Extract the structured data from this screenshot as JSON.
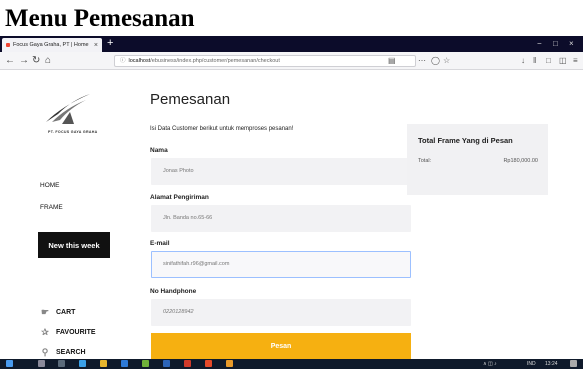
{
  "doc_title": "Menu Pemesanan",
  "browser": {
    "tab_title": "Focus Gaya Graha, PT | Home",
    "tab_close": "×",
    "new_tab": "+",
    "url_host": "localhost",
    "url_path": "/ebusiness/index.php/customer/pemesanan/checkout",
    "window_controls": [
      "−",
      "□",
      "×"
    ]
  },
  "icons": [
    "back-icon",
    "forward-icon",
    "reload-icon",
    "home-icon",
    "info-icon",
    "reader-icon",
    "more-icon",
    "pocket-icon",
    "star-icon",
    "download-icon",
    "library-icon",
    "sidebar-icon",
    "shield-icon",
    "menu-icon",
    "cart-icon",
    "favourite-icon",
    "search-icon"
  ],
  "sidebar": {
    "logo_caption": "PT. FOCUS GAYA GRAHA",
    "nav": [
      "HOME",
      "FRAME"
    ],
    "new_week_label": "New this week",
    "bottom": [
      {
        "icon": "cart-icon",
        "label": "CART"
      },
      {
        "icon": "favourite-icon",
        "label": "FAVOURITE"
      },
      {
        "icon": "search-icon",
        "label": "SEARCH"
      }
    ]
  },
  "form": {
    "title": "Pemesanan",
    "instruction": "Isi Data Customer berikut untuk memproses pesanan!",
    "fields": [
      {
        "label": "Nama",
        "value": "Jonas Photo"
      },
      {
        "label": "Alamat Pengiriman",
        "value": "Jln. Banda no.65-66"
      },
      {
        "label": "E-mail",
        "value": "sinifathifah.r96@gmail.com"
      },
      {
        "label": "No Handphone",
        "value": "0220128942"
      }
    ],
    "submit_label": "Pesan"
  },
  "summary": {
    "title": "Total Frame Yang di Pesan",
    "total_label": "Total:",
    "total_value": "Rp180,000.00"
  },
  "taskbar": {
    "tray_lang": "IND",
    "time": "13:24"
  },
  "colors": {
    "accent": "#f6b011",
    "tab_strip": "#0c0c2a",
    "focus_border": "#9cc0ff"
  }
}
